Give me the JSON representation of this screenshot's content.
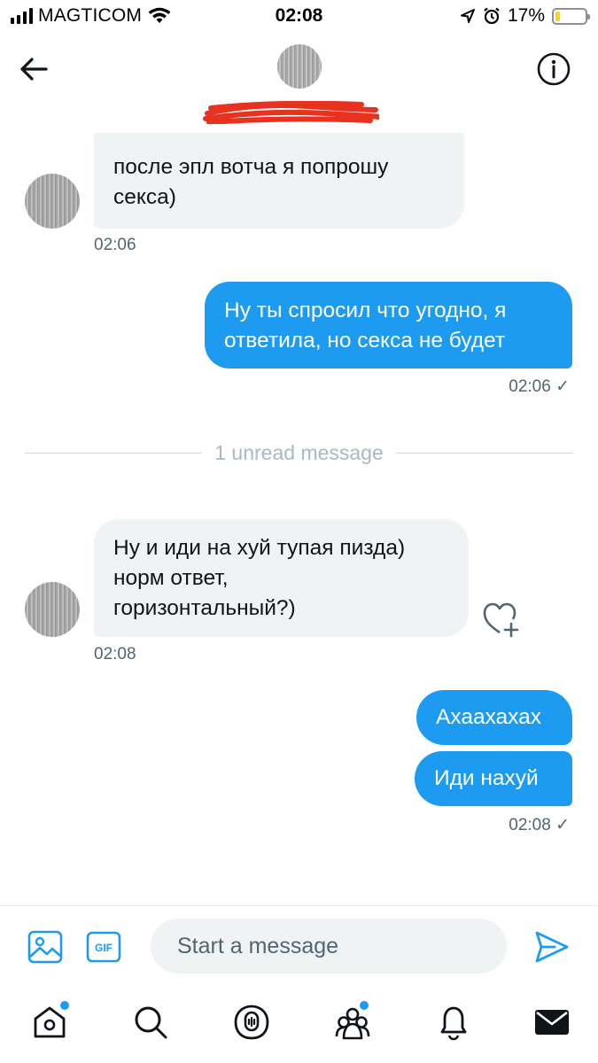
{
  "status_bar": {
    "carrier": "MAGTICOM",
    "time": "02:08",
    "battery_percent": "17%",
    "battery_level": 0.17,
    "icons": [
      "signal-icon",
      "wifi-icon",
      "location-icon",
      "alarm-icon",
      "battery-icon"
    ]
  },
  "header": {
    "back_icon": "arrow-left-icon",
    "info_icon": "info-icon"
  },
  "messages": [
    {
      "direction": "in",
      "lines": [
        "после эпл вотча я попрошу",
        "секса)"
      ],
      "time": "02:06"
    },
    {
      "direction": "out",
      "lines": [
        "Ну ты спросил что угодно, я",
        "ответила, но секса не будет"
      ],
      "time": "02:06 ✓"
    }
  ],
  "unread_divider": "1 unread message",
  "messages_after": [
    {
      "direction": "in",
      "lines": [
        "Ну и иди на хуй тупая пизда)",
        "норм ответ,",
        "горизонтальный?)"
      ],
      "time": "02:08"
    },
    {
      "direction": "out",
      "lines": [
        "Ахаахахах"
      ]
    },
    {
      "direction": "out",
      "lines": [
        "Иди нахуй"
      ],
      "time": "02:08 ✓"
    }
  ],
  "composer": {
    "placeholder": "Start a message",
    "gif_label": "GIF",
    "icons": [
      "image-icon",
      "gif-icon",
      "send-icon"
    ]
  },
  "tabbar": {
    "items": [
      "home-icon",
      "search-icon",
      "spaces-icon",
      "communities-icon",
      "notifications-icon",
      "messages-icon"
    ]
  },
  "colors": {
    "accent": "#1d9bf0",
    "incoming_bubble": "#eff3f4",
    "redaction": "#e8311e"
  }
}
